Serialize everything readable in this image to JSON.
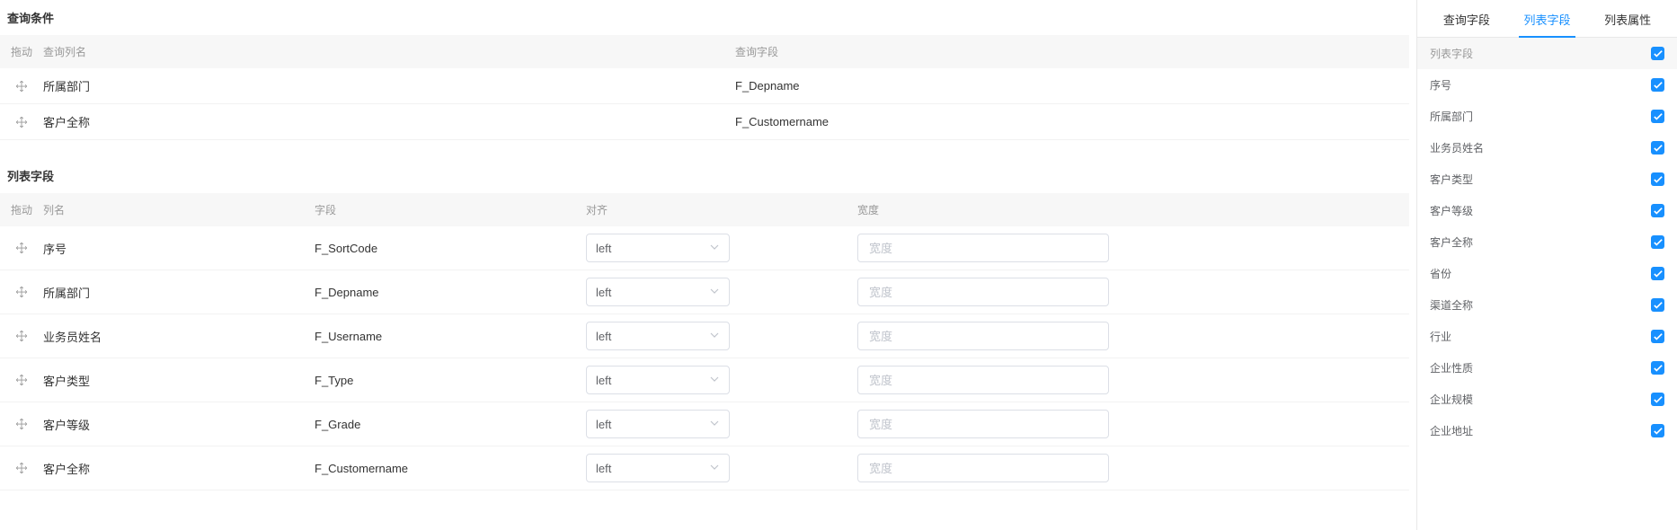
{
  "main": {
    "query_section": {
      "title": "查询条件",
      "headers": {
        "drag": "拖动",
        "name": "查询列名",
        "field": "查询字段"
      },
      "rows": [
        {
          "name": "所属部门",
          "field": "F_Depname"
        },
        {
          "name": "客户全称",
          "field": "F_Customername"
        }
      ]
    },
    "list_section": {
      "title": "列表字段",
      "headers": {
        "drag": "拖动",
        "name": "列名",
        "field": "字段",
        "align": "对齐",
        "width": "宽度"
      },
      "align_value": "left",
      "width_placeholder": "宽度",
      "rows": [
        {
          "name": "序号",
          "field": "F_SortCode"
        },
        {
          "name": "所属部门",
          "field": "F_Depname"
        },
        {
          "name": "业务员姓名",
          "field": "F_Username"
        },
        {
          "name": "客户类型",
          "field": "F_Type"
        },
        {
          "name": "客户等级",
          "field": "F_Grade"
        },
        {
          "name": "客户全称",
          "field": "F_Customername"
        }
      ]
    }
  },
  "sidebar": {
    "tabs": [
      "查询字段",
      "列表字段",
      "列表属性"
    ],
    "active_tab": 1,
    "header_label": "列表字段",
    "fields": [
      "序号",
      "所属部门",
      "业务员姓名",
      "客户类型",
      "客户等级",
      "客户全称",
      "省份",
      "渠道全称",
      "行业",
      "企业性质",
      "企业规模",
      "企业地址"
    ]
  }
}
